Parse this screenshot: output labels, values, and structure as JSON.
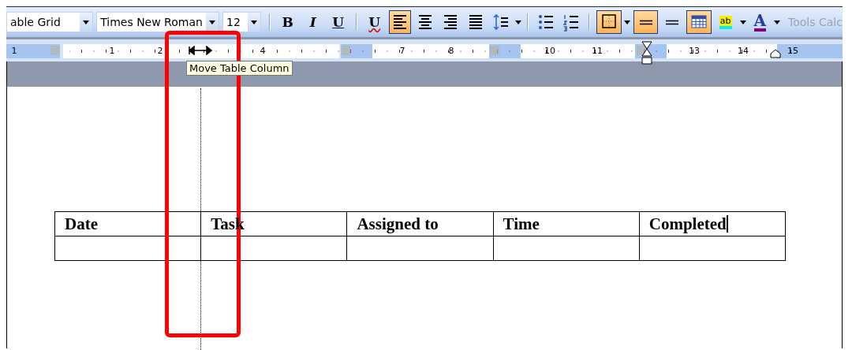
{
  "toolbar": {
    "style_box": {
      "value": "able Grid"
    },
    "font_box": {
      "value": "Times New Roman"
    },
    "size_box": {
      "value": "12"
    },
    "items": [
      {
        "kind": "separator"
      },
      {
        "kind": "bold",
        "label": "B",
        "selected": false,
        "menu": false
      },
      {
        "kind": "italic",
        "label": "I",
        "selected": false,
        "menu": false
      },
      {
        "kind": "underline",
        "label": "U",
        "selected": false,
        "menu": false
      },
      {
        "kind": "separator"
      },
      {
        "kind": "double-underline",
        "label": "U",
        "selected": false,
        "menu": false
      },
      {
        "kind": "align-left",
        "selected": true,
        "menu": false
      },
      {
        "kind": "align-center",
        "selected": false,
        "menu": false
      },
      {
        "kind": "align-right",
        "selected": false,
        "menu": false
      },
      {
        "kind": "justify",
        "selected": false,
        "menu": false
      },
      {
        "kind": "line-spacing",
        "selected": false,
        "menu": true
      },
      {
        "kind": "separator"
      },
      {
        "kind": "bullets",
        "selected": false,
        "menu": false
      },
      {
        "kind": "numbering",
        "selected": false,
        "menu": false
      },
      {
        "kind": "separator"
      },
      {
        "kind": "borders",
        "selected": true,
        "menu": true
      },
      {
        "kind": "line-style",
        "selected": true,
        "menu": false
      },
      {
        "kind": "line-weight",
        "selected": false,
        "menu": false
      },
      {
        "kind": "table",
        "selected": true,
        "menu": false
      },
      {
        "kind": "highlight",
        "label": "ab",
        "selected": false,
        "menu": true
      },
      {
        "kind": "font-color",
        "label": "A",
        "selected": false,
        "menu": true
      }
    ],
    "menu_label": {
      "text": "Tools Calc",
      "disabled": true
    }
  },
  "ruler": {
    "numbers": [
      "1",
      "1",
      "2",
      "4",
      "7",
      "8",
      "10",
      "11",
      "13",
      "14",
      "15"
    ]
  },
  "tooltip": {
    "text": "Move Table Column"
  },
  "annotation": {
    "kind": "rectangle"
  },
  "table": {
    "columns": [
      {
        "text": "Date",
        "cursor": false
      },
      {
        "text": "Task",
        "cursor": false
      },
      {
        "text": "Assigned to",
        "cursor": false
      },
      {
        "text": "Time",
        "cursor": false
      },
      {
        "text": "Completed",
        "cursor": true
      }
    ]
  }
}
